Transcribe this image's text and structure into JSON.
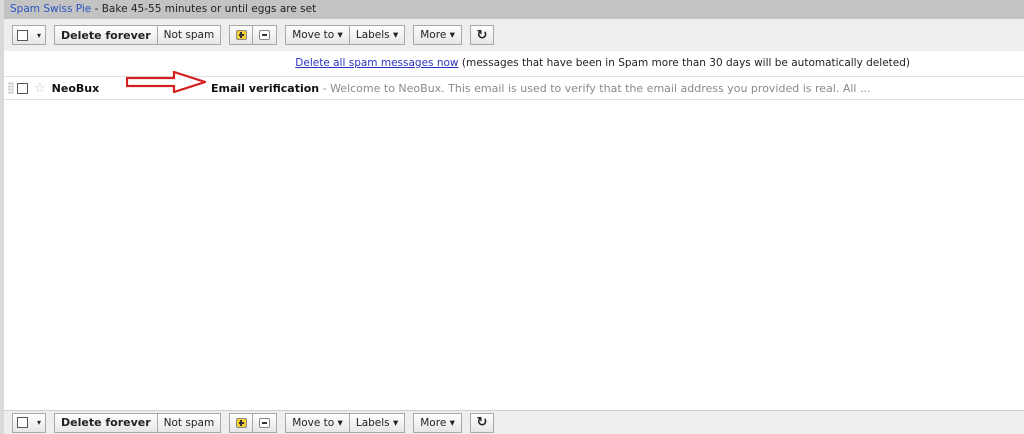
{
  "tip": {
    "link": "Spam Swiss Pie",
    "text": " - Bake 45-55 minutes or until eggs are set"
  },
  "toolbar": {
    "select_caret": "▾",
    "delete_forever": "Delete forever",
    "not_spam": "Not spam",
    "move_to": "Move to ▾",
    "labels": "Labels ▾",
    "more": "More ▾",
    "refresh": "↻"
  },
  "notice": {
    "link": "Delete all spam messages now",
    "text": " (messages that have been in Spam more than 30 days will be automatically deleted)"
  },
  "message": {
    "sender": "NeoBux",
    "subject": "Email verification",
    "snippet": " - Welcome to NeoBux. This email is used to verify that the email address you provided is real. All ..."
  },
  "icons": {
    "important": "mark-important-icon",
    "not_important": "mark-not-important-icon",
    "star": "star-icon",
    "arrow": "red-arrow-annotation"
  },
  "colors": {
    "arrow": "#d42020",
    "link": "#2a33c0",
    "toolbar_bg": "#eeeeee"
  }
}
